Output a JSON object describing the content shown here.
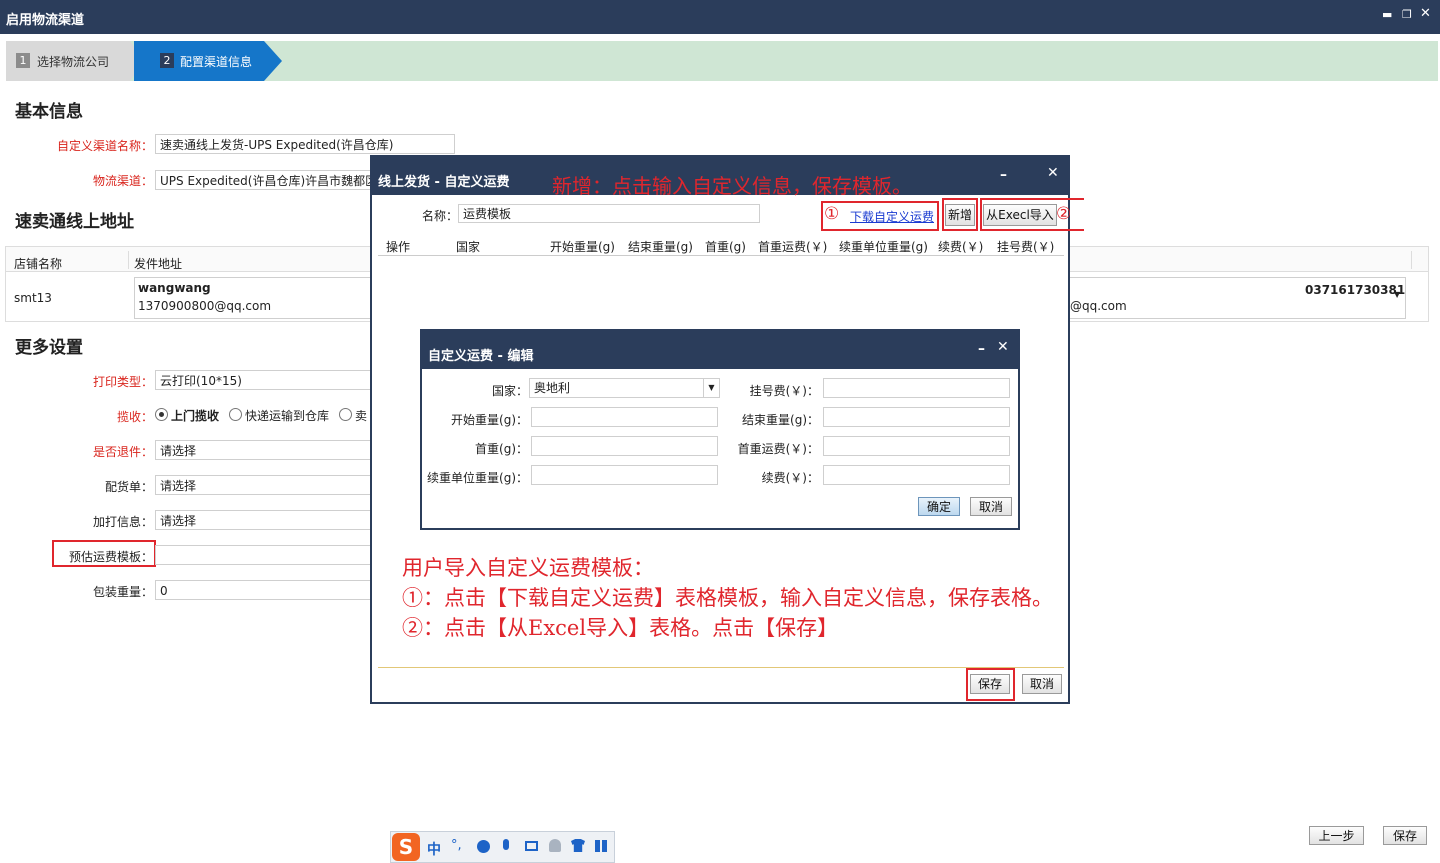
{
  "window": {
    "title": "启用物流渠道",
    "min_icon": "minimize-icon",
    "restore_icon": "restore-icon",
    "close_icon": "close-icon"
  },
  "steps": [
    {
      "num": "1",
      "label": "选择物流公司"
    },
    {
      "num": "2",
      "label": "配置渠道信息"
    }
  ],
  "basic": {
    "title": "基本信息",
    "channel_name_label": "自定义渠道名称：",
    "channel_name_value": "速卖通线上发货-UPS Expedited(许昌仓库)",
    "logistics_label": "物流渠道：",
    "logistics_value": "UPS Expedited(许昌仓库)许昌市魏都区"
  },
  "address": {
    "title": "速卖通线上地址",
    "col_shop": "店铺名称",
    "col_addr": "发件地址",
    "shop": "smt13",
    "name": "wangwang",
    "email": "1370900800@qq.com",
    "email_right": "@qq.com",
    "phone": "037161730381"
  },
  "more": {
    "title": "更多设置",
    "print_type_label": "打印类型：",
    "print_type_value": "云打印(10*15)",
    "pickup_label": "揽收：",
    "pickup_options": [
      "上门揽收",
      "快递运输到仓库",
      "卖"
    ],
    "return_label": "是否退件：",
    "return_value": "请选择",
    "packing_label": "配货单：",
    "packing_value": "请选择",
    "extra_label": "加打信息：",
    "extra_value": "请选择",
    "template_label": "预估运费模板：",
    "template_value": "",
    "weight_label": "包装重量：",
    "weight_value": "0"
  },
  "dialog_outer": {
    "title": "线上发货 - 自定义运费",
    "name_label": "名称：",
    "name_value": "运费模板",
    "download_link": "下载自定义运费",
    "add_button": "新增",
    "import_button": "从Execl导入",
    "columns": [
      "操作",
      "国家",
      "开始重量(g)",
      "结束重量(g)",
      "首重(g)",
      "首重运费(￥)",
      "续重单位重量(g)",
      "续费(￥)",
      "挂号费(￥)"
    ],
    "save": "保存",
    "cancel": "取消"
  },
  "dialog_inner": {
    "title": "自定义运费 - 编辑",
    "country_label": "国家：",
    "country_value": "奥地利",
    "reg_fee_label": "挂号费(￥)：",
    "start_weight_label": "开始重量(g)：",
    "end_weight_label": "结束重量(g)：",
    "first_weight_label": "首重(g)：",
    "first_fee_label": "首重运费(￥)：",
    "unit_weight_label": "续重单位重量(g)：",
    "renew_fee_label": "续费(￥)：",
    "ok": "确定",
    "cancel": "取消"
  },
  "annotations": {
    "top": "新增：点击输入自定义信息，保存模板。",
    "marker1": "①",
    "marker2": "②",
    "line1": "用户导入自定义运费模板：",
    "line2": "①：点击【下载自定义运费】表格模板，输入自定义信息，保存表格。",
    "line3": "②：点击【从Excel导入】表格。点击【保存】",
    "color": "#e0262d"
  },
  "footer": {
    "prev": "上一步",
    "save": "保存"
  },
  "ime": {
    "label": "中",
    "punct": "°,"
  }
}
